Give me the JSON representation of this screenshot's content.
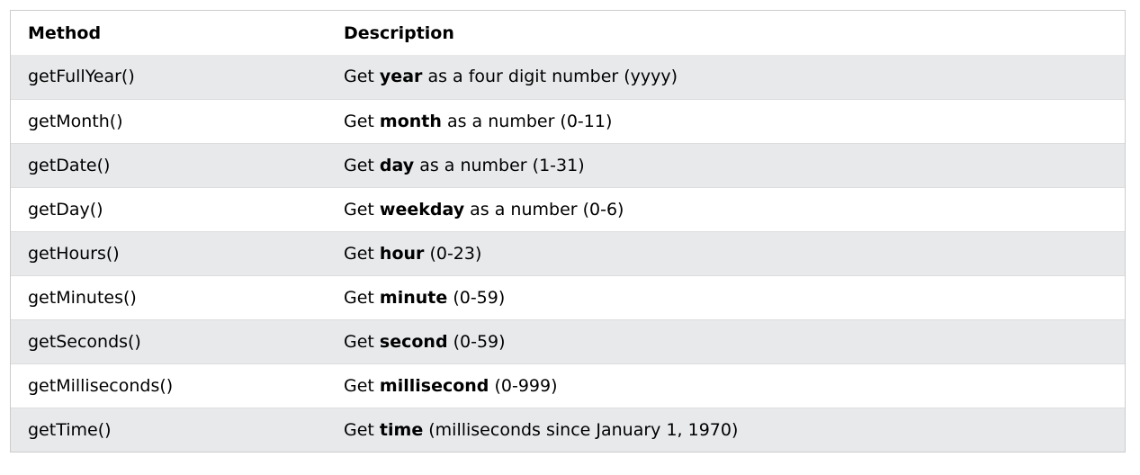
{
  "table": {
    "headers": {
      "method": "Method",
      "description": "Description"
    },
    "rows": [
      {
        "method": "getFullYear()",
        "prefix": "Get",
        "bold": "year",
        "suffix": "as a four digit number (yyyy)"
      },
      {
        "method": "getMonth()",
        "prefix": "Get",
        "bold": "month",
        "suffix": "as a number (0-11)"
      },
      {
        "method": "getDate()",
        "prefix": "Get",
        "bold": "day",
        "suffix": "as a number (1-31)"
      },
      {
        "method": "getDay()",
        "prefix": "Get",
        "bold": "weekday",
        "suffix": "as a number (0-6)"
      },
      {
        "method": "getHours()",
        "prefix": "Get",
        "bold": "hour",
        "suffix": "(0-23)"
      },
      {
        "method": "getMinutes()",
        "prefix": "Get",
        "bold": "minute",
        "suffix": "(0-59)"
      },
      {
        "method": "getSeconds()",
        "prefix": "Get",
        "bold": "second",
        "suffix": "(0-59)"
      },
      {
        "method": "getMilliseconds()",
        "prefix": "Get",
        "bold": "millisecond",
        "suffix": "(0-999)"
      },
      {
        "method": "getTime()",
        "prefix": "Get",
        "bold": "time",
        "suffix": "(milliseconds since January 1, 1970)"
      }
    ]
  },
  "colors": {
    "stripe": "#e7e9eb",
    "border": "#cccccc",
    "background": "#ffffff"
  }
}
